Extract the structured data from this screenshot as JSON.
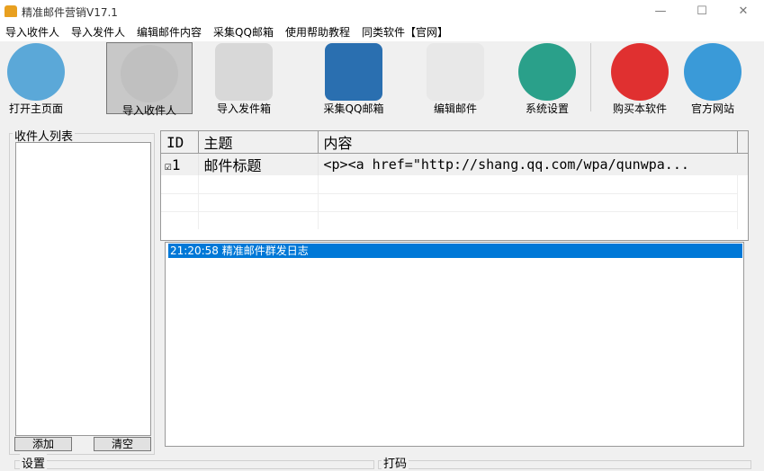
{
  "window": {
    "title": "精准邮件营销V17.1",
    "minimize": "—",
    "maximize": "☐",
    "close": "✕"
  },
  "menu": [
    "导入收件人",
    "导入发件人",
    "编辑邮件内容",
    "采集QQ邮箱",
    "使用帮助教程",
    "同类软件【官网】"
  ],
  "toolbar": [
    {
      "label": "打开主页面",
      "icon": "envelope-icon",
      "color": "#5ba8d8"
    },
    {
      "label": "导入收件人",
      "icon": "user-check-icon",
      "color": "#c0c0c0"
    },
    {
      "label": "导入发件箱",
      "icon": "message-arrow-icon",
      "color": "#d8d8d8"
    },
    {
      "label": "采集QQ邮箱",
      "icon": "qq-penguin-icon",
      "color": "#2a6fb0"
    },
    {
      "label": "编辑邮件",
      "icon": "mail-edit-icon",
      "color": "#e8e8e8"
    },
    {
      "label": "系统设置",
      "icon": "settings-list-icon",
      "color": "#2aa08a"
    },
    {
      "label": "购买本软件",
      "icon": "cart-icon",
      "color": "#e03030"
    },
    {
      "label": "官方网站",
      "icon": "globe-icon",
      "color": "#3a9ad8"
    }
  ],
  "recipients": {
    "title": "收件人列表",
    "add": "添加",
    "clear": "清空"
  },
  "mail_table": {
    "headers": [
      "ID",
      "主题",
      "内容"
    ],
    "rows": [
      {
        "checked": true,
        "id": "1",
        "subject": "邮件标题",
        "content": "<p><a href=\"http://shang.qq.com/wpa/qunwpa..."
      }
    ]
  },
  "log": {
    "entries": [
      "21:20:58 精准邮件群发日志"
    ]
  },
  "bottom": {
    "settings": "设置",
    "captcha": "打码"
  }
}
